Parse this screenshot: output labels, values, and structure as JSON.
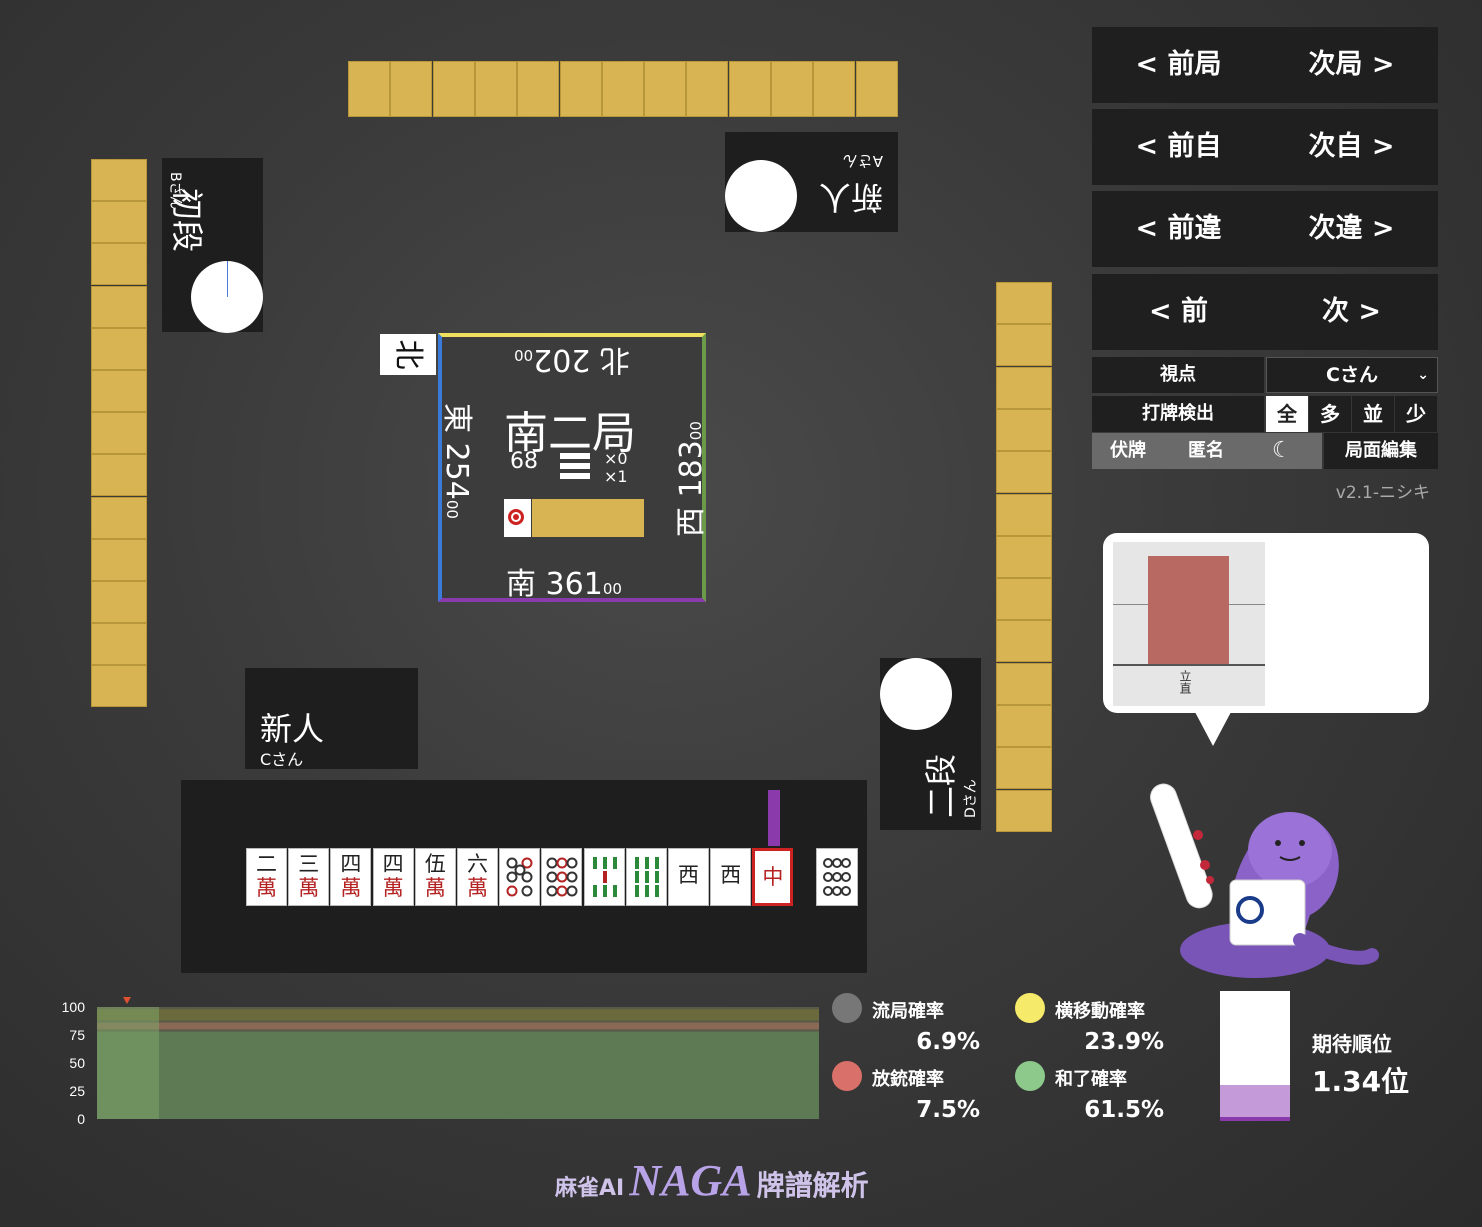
{
  "table": {
    "round": "南二局",
    "honba_count": "68",
    "riichi_sticks": "×0",
    "honba_sticks": "×1",
    "seat_indicator": "北",
    "scores": {
      "north": {
        "wind": "北",
        "main": "202",
        "sub": "00"
      },
      "east": {
        "wind": "東",
        "main": "254",
        "sub": "00"
      },
      "west": {
        "wind": "西",
        "main": "183",
        "sub": "00"
      },
      "south": {
        "wind": "南",
        "main": "361",
        "sub": "00"
      }
    }
  },
  "players": {
    "top": {
      "rank": "新人",
      "name": "Aさん"
    },
    "left": {
      "rank": "初段",
      "name": "Bさん"
    },
    "self": {
      "rank": "新人",
      "name": "Cさん"
    },
    "right": {
      "rank": "二段",
      "name": "Dさん"
    }
  },
  "hand": {
    "tiles": [
      {
        "top": "二",
        "bottom": "萬"
      },
      {
        "top": "三",
        "bottom": "萬"
      },
      {
        "top": "四",
        "bottom": "萬"
      },
      {
        "top": "四",
        "bottom": "萬"
      },
      {
        "top": "伍",
        "bottom": "萬"
      },
      {
        "top": "六",
        "bottom": "萬"
      },
      {
        "top": "",
        "bottom": ""
      },
      {
        "top": "",
        "bottom": ""
      },
      {
        "top": "",
        "bottom": ""
      },
      {
        "top": "",
        "bottom": ""
      },
      {
        "top": "西",
        "bottom": ""
      },
      {
        "top": "西",
        "bottom": ""
      },
      {
        "top": "中",
        "bottom": ""
      }
    ],
    "drawn_tile_icon": "pin-9-icon"
  },
  "controls": {
    "prev_round": "< 前局",
    "next_round": "次局 >",
    "prev_self": "< 前自",
    "next_self": "次自 >",
    "prev_diff": "< 前違",
    "next_diff": "次違 >",
    "prev": "< 前",
    "next": "次 >",
    "viewpoint_label": "視点",
    "viewpoint_value": "Cさん",
    "detect_label": "打牌検出",
    "detect_options": [
      "全",
      "多",
      "並",
      "少"
    ],
    "hide_tiles": "伏牌",
    "anonymous": "匿名",
    "edit_board": "局面編集",
    "version": "v2.1-ニシキ"
  },
  "bubble": {
    "bar_label": "立直",
    "bar_value_percent": 95
  },
  "stats": {
    "ryukyoku_label": "流局確率",
    "ryukyoku_value": "6.9%",
    "yokoido_label": "横移動確率",
    "yokoido_value": "23.9%",
    "houjuu_label": "放銃確率",
    "houjuu_value": "7.5%",
    "agari_label": "和了確率",
    "agari_value": "61.5%",
    "expected_rank_label": "期待順位",
    "expected_rank_value": "1.34位",
    "colors": {
      "ryukyoku": "#777777",
      "yokoido": "#f5ea6a",
      "houjuu": "#d9706a",
      "agari": "#8cc98a"
    }
  },
  "chart_data": {
    "type": "area",
    "yticks": [
      "100",
      "75",
      "50",
      "25",
      "0"
    ],
    "ylim": [
      0,
      100
    ],
    "series": []
  },
  "footer": {
    "title_small": "麻雀AI",
    "title_big": "NAGA",
    "title_tail": "牌譜解析"
  }
}
